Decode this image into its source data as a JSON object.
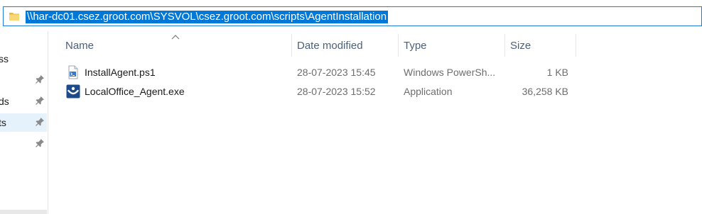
{
  "address_bar": {
    "path": "\\\\har-dc01.csez.groot.com\\SYSVOL\\csez.groot.com\\scripts\\AgentInstallation",
    "icon": "folder-icon"
  },
  "navigation_pane": {
    "items": [
      {
        "label": "ss",
        "pinned": false,
        "selected": false
      },
      {
        "label": "",
        "pinned": true,
        "selected": false
      },
      {
        "label": "ds",
        "pinned": true,
        "selected": false
      },
      {
        "label": "ts",
        "pinned": true,
        "selected": true
      },
      {
        "label": "",
        "pinned": true,
        "selected": false
      }
    ],
    "pin_icon": "pin-icon"
  },
  "file_list": {
    "columns": {
      "name": "Name",
      "date_modified": "Date modified",
      "type": "Type",
      "size": "Size"
    },
    "sorted_by": "Name",
    "sort_direction": "ascending",
    "files": [
      {
        "name": "InstallAgent.ps1",
        "date_modified": "28-07-2023 15:45",
        "type": "Windows PowerSh...",
        "size": "1 KB",
        "icon": "powershell-script-icon"
      },
      {
        "name": "LocalOffice_Agent.exe",
        "date_modified": "28-07-2023 15:52",
        "type": "Application",
        "size": "36,258 KB",
        "icon": "application-icon"
      }
    ]
  },
  "colors": {
    "selection": "#0078d7",
    "address_border": "#1f7bd6",
    "nav_selected": "#e5f1fb",
    "header_text": "#4c607a",
    "secondary_text": "#6d6d6d"
  }
}
